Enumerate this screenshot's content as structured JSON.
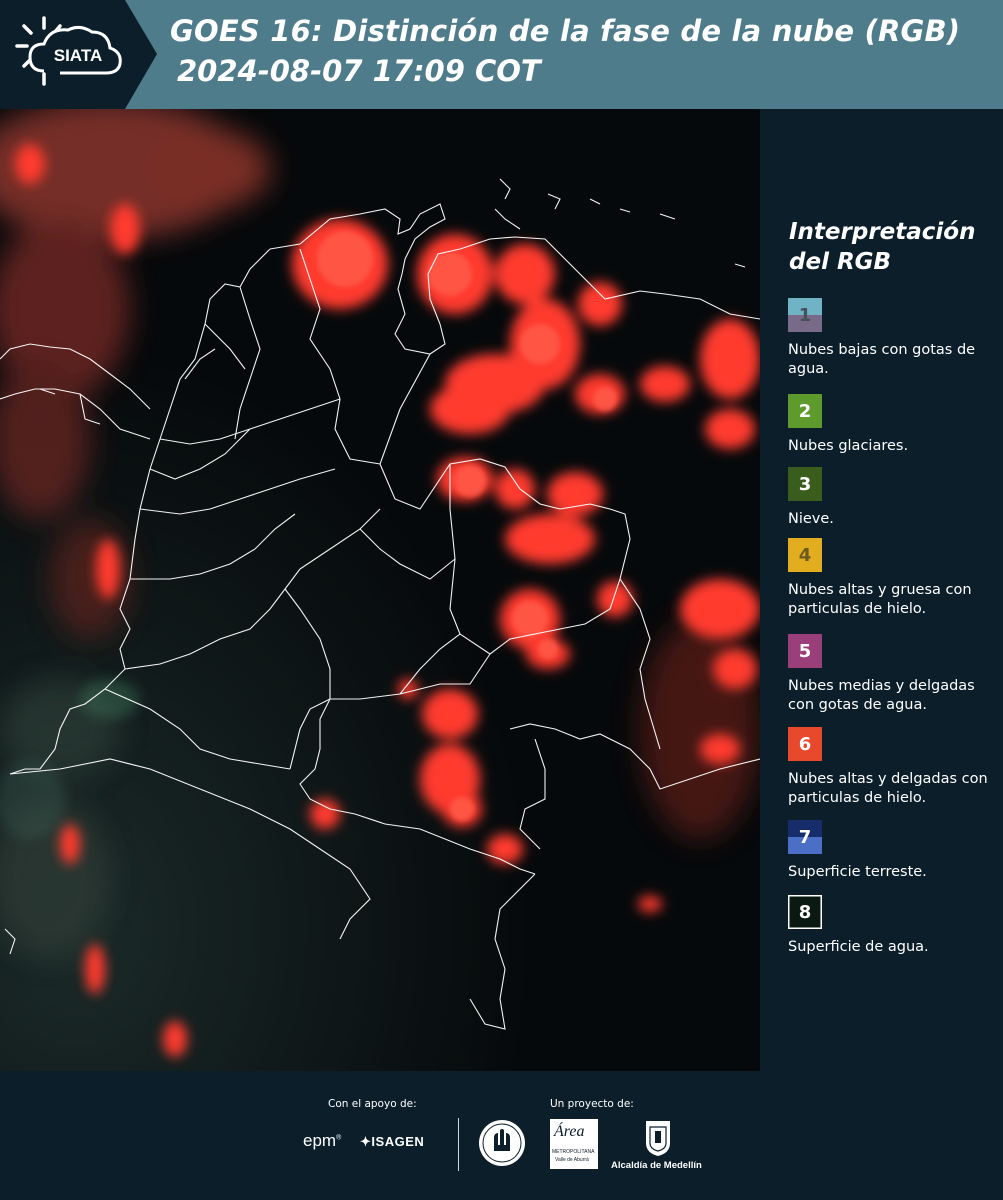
{
  "header": {
    "logo_text": "SIATA",
    "title_line1": "GOES 16: Distinción de la fase de la nube (RGB)",
    "title_line2": "2024-08-07 17:09 COT"
  },
  "legend": {
    "title_line1": "Interpretación",
    "title_line2": "del RGB",
    "items": [
      {
        "num": "1",
        "label": "Nubes bajas con gotas de agua.",
        "color_top": "#6fb3c4",
        "color_bottom": "#7a6a8a"
      },
      {
        "num": "2",
        "label": "Nubes glaciares.",
        "color_top": "#5f9a2c",
        "color_bottom": "#5f9a2c"
      },
      {
        "num": "3",
        "label": "Nieve.",
        "color_top": "#3a5c1c",
        "color_bottom": "#3a5c1c"
      },
      {
        "num": "4",
        "label": "Nubes altas y gruesa con particulas de hielo.",
        "color_top": "#e2ad1f",
        "color_bottom": "#e2ad1f"
      },
      {
        "num": "5",
        "label": "Nubes medias y delgadas con gotas de agua.",
        "color_top": "#9b3f7a",
        "color_bottom": "#9b3f7a"
      },
      {
        "num": "6",
        "label": "Nubes altas y delgadas con particulas de hielo.",
        "color_top": "#e8482c",
        "color_bottom": "#e8482c"
      },
      {
        "num": "7",
        "label": "Superficie terreste.",
        "color_top": "#152d6b",
        "color_bottom": "#4b6fc7"
      },
      {
        "num": "8",
        "label": "Superficie de agua.",
        "color_top": "#0a1a12",
        "color_bottom": "#0a1a12"
      }
    ]
  },
  "footer": {
    "support_label": "Con el apoyo de:",
    "project_label": "Un proyecto de:",
    "sponsor1": "epm",
    "sponsor2": "ISAGEN",
    "partner1_line1": "Área",
    "partner1_line2": "METROPOLITANA",
    "partner1_line3": "Valle de Aburrá",
    "partner2": "Alcaldía de Medellín"
  },
  "colors": {
    "header_bg": "#4e7c8b",
    "panel_bg": "#0b1e2a",
    "cloud_red": "#ff3b2e",
    "border_white": "#ffffff"
  }
}
